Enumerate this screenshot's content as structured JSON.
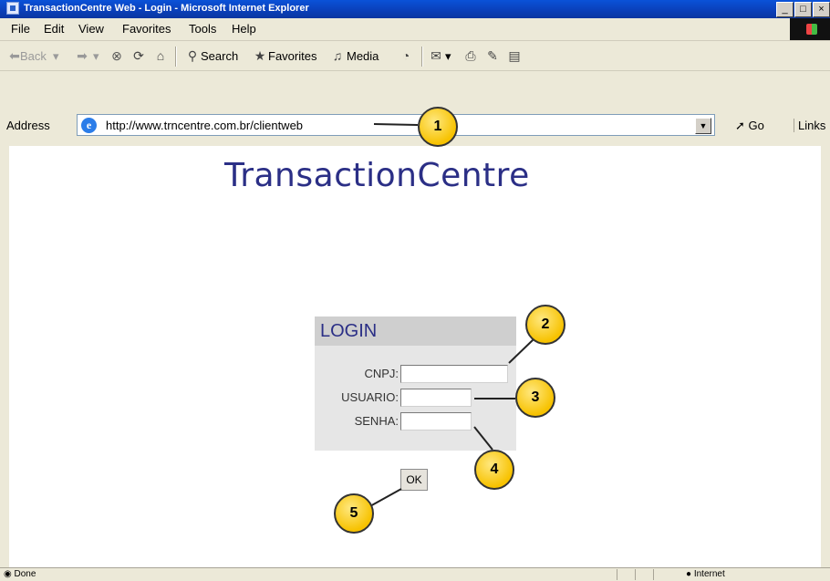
{
  "window": {
    "title": "TransactionCentre Web - Login - Microsoft Internet Explorer"
  },
  "menu": [
    "File",
    "Edit",
    "View",
    "Favorites",
    "Tools",
    "Help"
  ],
  "toolbar": {
    "back": "Back",
    "search": "Search",
    "favorites": "Favorites",
    "media": "Media"
  },
  "address": {
    "label": "Address",
    "url": "http://www.trncentre.com.br/clientweb",
    "go": "Go",
    "links": "Links"
  },
  "page": {
    "site_title": "TransactionCentre",
    "login_title": "LOGIN",
    "fields": {
      "cnpj": "CNPJ:",
      "usuario": "USUARIO:",
      "senha": "SENHA:"
    },
    "ok_label": "OK"
  },
  "status": {
    "left": "Done",
    "zone": "Internet"
  },
  "callouts": [
    "1",
    "2",
    "3",
    "4",
    "5"
  ],
  "colors": {
    "title_bar": "#0a4cd0",
    "brand_text": "#2b2f86",
    "callout": "#f7c200",
    "login_panel": "#e6e6e6"
  }
}
